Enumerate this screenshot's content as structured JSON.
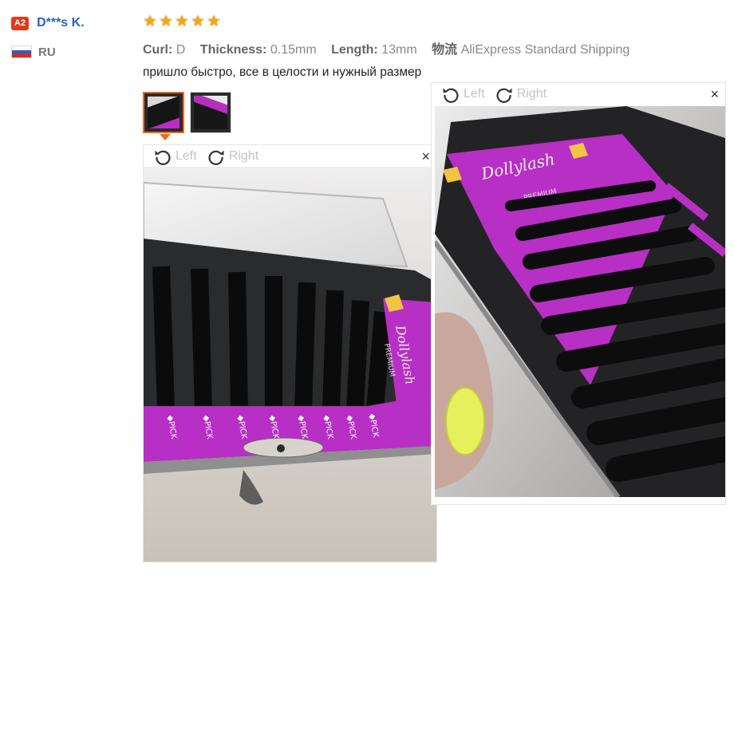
{
  "reviewer": {
    "level_badge": "A2",
    "name": "D***s K.",
    "country_code": "RU"
  },
  "review": {
    "rating": 5,
    "attributes": [
      {
        "label": "Curl:",
        "value": "D"
      },
      {
        "label": "Thickness:",
        "value": "0.15mm"
      },
      {
        "label": "Length:",
        "value": "13mm"
      },
      {
        "label": "物流",
        "value": "AliExpress Standard Shipping"
      }
    ],
    "text": "пришло быстро, все в целости и нужный размер"
  },
  "viewer1": {
    "rotate_left_label": "Left",
    "rotate_right_label": "Right",
    "close_glyph": "×",
    "brand_text": "Dollylash",
    "premium_text": "PREMIUM",
    "pick_label": "PICK"
  },
  "viewer2": {
    "rotate_left_label": "Left",
    "rotate_right_label": "Right",
    "close_glyph": "×",
    "brand_text": "Dollylash",
    "premium_text": "PREMIUM"
  },
  "colors": {
    "star": "#f5a623",
    "accent_orange": "#f06a1b",
    "name_blue": "#2466c7",
    "badge_red": "#e0391a",
    "lash_tray_purple": "#b72fc4"
  },
  "icons": {
    "rotate_left": "rotate-ccw-icon",
    "rotate_right": "rotate-cw-icon",
    "star": "star-icon",
    "flag": "russia-flag-icon"
  }
}
